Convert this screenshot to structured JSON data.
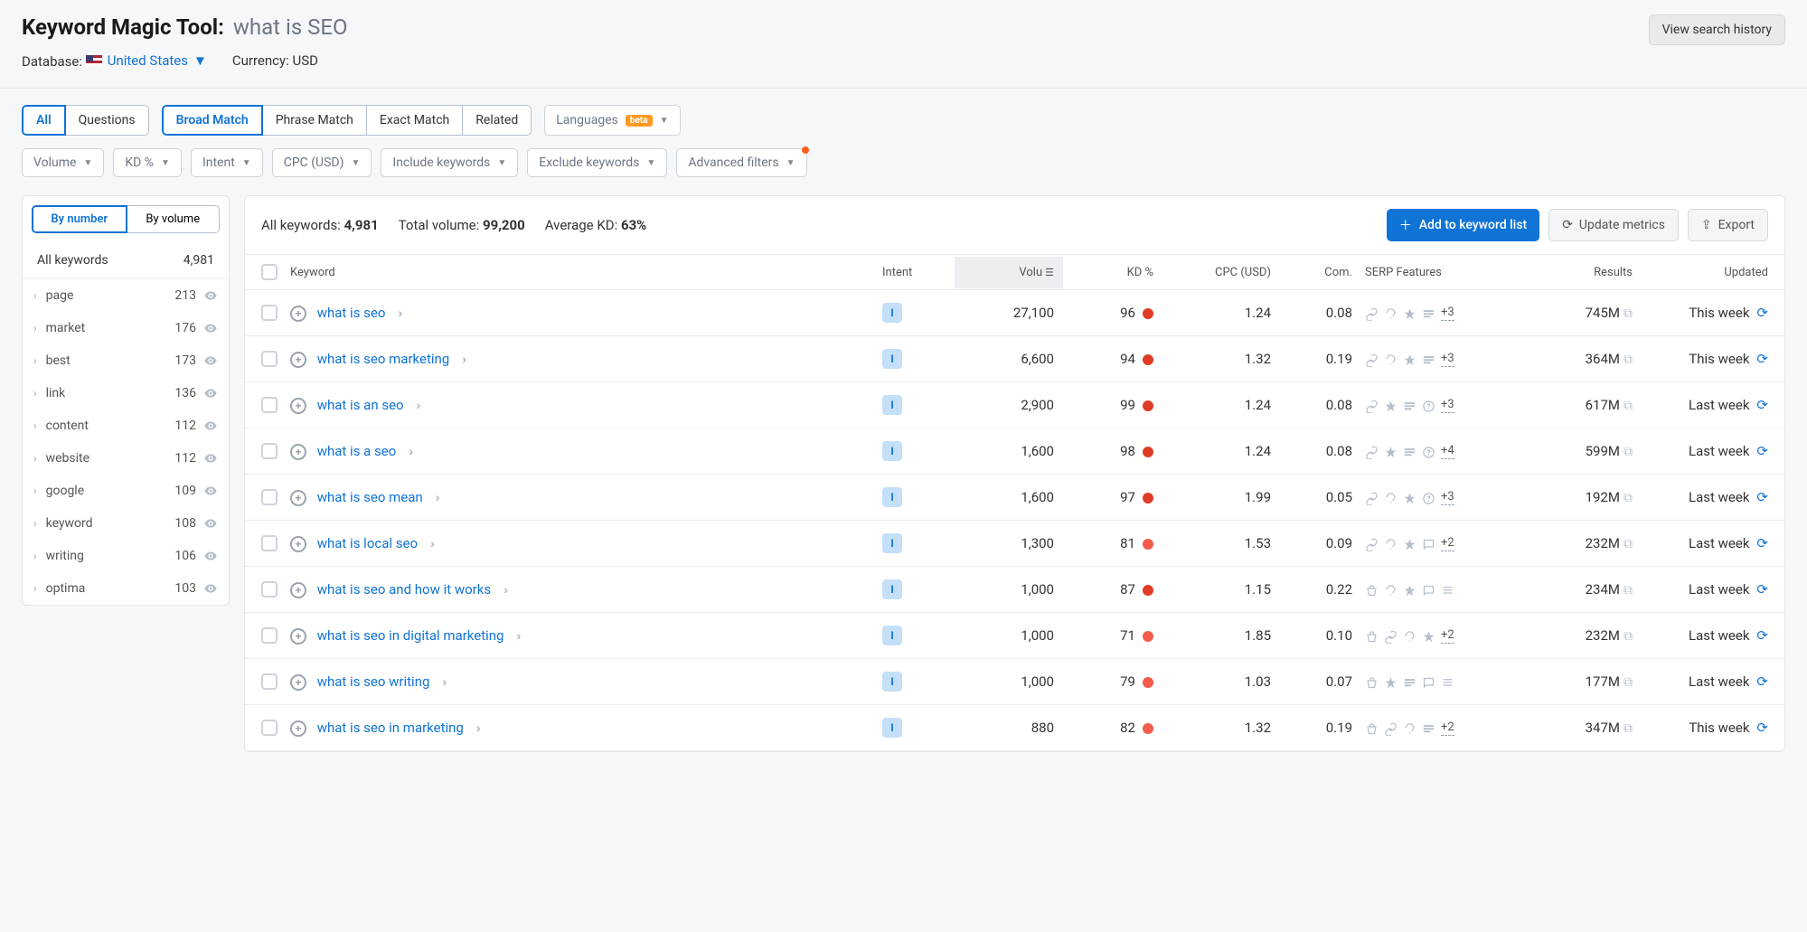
{
  "header": {
    "tool_name": "Keyword Magic Tool:",
    "query": "what is SEO",
    "history_btn": "View search history",
    "database_label": "Database:",
    "country": "United States",
    "currency_label": "Currency:",
    "currency": "USD"
  },
  "tabs1": {
    "all": "All",
    "questions": "Questions"
  },
  "tabs2": {
    "broad": "Broad Match",
    "phrase": "Phrase Match",
    "exact": "Exact Match",
    "related": "Related"
  },
  "languages": {
    "label": "Languages",
    "badge": "beta"
  },
  "filters": {
    "volume": "Volume",
    "kd": "KD %",
    "intent": "Intent",
    "cpc": "CPC (USD)",
    "include": "Include keywords",
    "exclude": "Exclude keywords",
    "advanced": "Advanced filters"
  },
  "sidebar": {
    "by_number": "By number",
    "by_volume": "By volume",
    "all_keywords": "All keywords",
    "total": "4,981",
    "items": [
      {
        "name": "page",
        "count": "213"
      },
      {
        "name": "market",
        "count": "176"
      },
      {
        "name": "best",
        "count": "173"
      },
      {
        "name": "link",
        "count": "136"
      },
      {
        "name": "content",
        "count": "112"
      },
      {
        "name": "website",
        "count": "112"
      },
      {
        "name": "google",
        "count": "109"
      },
      {
        "name": "keyword",
        "count": "108"
      },
      {
        "name": "writing",
        "count": "106"
      },
      {
        "name": "optima",
        "count": "103"
      }
    ]
  },
  "stats": {
    "all_label": "All keywords:",
    "all_val": "4,981",
    "vol_label": "Total volume:",
    "vol_val": "99,200",
    "kd_label": "Average KD:",
    "kd_val": "63%"
  },
  "actions": {
    "add": "Add to keyword list",
    "update": "Update metrics",
    "export": "Export"
  },
  "columns": {
    "keyword": "Keyword",
    "intent": "Intent",
    "volume": "Volu",
    "kd": "KD %",
    "cpc": "CPC (USD)",
    "com": "Com.",
    "serp": "SERP Features",
    "results": "Results",
    "updated": "Updated"
  },
  "rows": [
    {
      "kw": "what is seo",
      "intent": "I",
      "vol": "27,100",
      "kd": "96",
      "kd_dot": "high",
      "cpc": "1.24",
      "com": "0.08",
      "serp": [
        "link",
        "question",
        "star",
        "snippet"
      ],
      "more": "+3",
      "results": "745M",
      "updated": "This week"
    },
    {
      "kw": "what is seo marketing",
      "intent": "I",
      "vol": "6,600",
      "kd": "94",
      "kd_dot": "high",
      "cpc": "1.32",
      "com": "0.19",
      "serp": [
        "link",
        "question",
        "star",
        "snippet"
      ],
      "more": "+3",
      "results": "364M",
      "updated": "This week"
    },
    {
      "kw": "what is an seo",
      "intent": "I",
      "vol": "2,900",
      "kd": "99",
      "kd_dot": "high",
      "cpc": "1.24",
      "com": "0.08",
      "serp": [
        "link",
        "star",
        "snippet",
        "faq"
      ],
      "more": "+3",
      "results": "617M",
      "updated": "Last week"
    },
    {
      "kw": "what is a seo",
      "intent": "I",
      "vol": "1,600",
      "kd": "98",
      "kd_dot": "high",
      "cpc": "1.24",
      "com": "0.08",
      "serp": [
        "link",
        "star",
        "snippet",
        "faq"
      ],
      "more": "+4",
      "results": "599M",
      "updated": "Last week"
    },
    {
      "kw": "what is seo mean",
      "intent": "I",
      "vol": "1,600",
      "kd": "97",
      "kd_dot": "high",
      "cpc": "1.99",
      "com": "0.05",
      "serp": [
        "link",
        "question",
        "star",
        "faq"
      ],
      "more": "+3",
      "results": "192M",
      "updated": "Last week"
    },
    {
      "kw": "what is local seo",
      "intent": "I",
      "vol": "1,300",
      "kd": "81",
      "kd_dot": "med",
      "cpc": "1.53",
      "com": "0.09",
      "serp": [
        "link",
        "question",
        "star",
        "review"
      ],
      "more": "+2",
      "results": "232M",
      "updated": "Last week"
    },
    {
      "kw": "what is seo and how it works",
      "intent": "I",
      "vol": "1,000",
      "kd": "87",
      "kd_dot": "high",
      "cpc": "1.15",
      "com": "0.22",
      "serp": [
        "shop",
        "question",
        "star",
        "review",
        "list"
      ],
      "more": "",
      "results": "234M",
      "updated": "Last week"
    },
    {
      "kw": "what is seo in digital marketing",
      "intent": "I",
      "vol": "1,000",
      "kd": "71",
      "kd_dot": "med",
      "cpc": "1.85",
      "com": "0.10",
      "serp": [
        "shop",
        "link",
        "question",
        "star"
      ],
      "more": "+2",
      "results": "232M",
      "updated": "Last week"
    },
    {
      "kw": "what is seo writing",
      "intent": "I",
      "vol": "1,000",
      "kd": "79",
      "kd_dot": "med",
      "cpc": "1.03",
      "com": "0.07",
      "serp": [
        "shop",
        "star",
        "snippet",
        "review",
        "list"
      ],
      "more": "",
      "results": "177M",
      "updated": "Last week"
    },
    {
      "kw": "what is seo in marketing",
      "intent": "I",
      "vol": "880",
      "kd": "82",
      "kd_dot": "med",
      "cpc": "1.32",
      "com": "0.19",
      "serp": [
        "shop",
        "link",
        "question",
        "snippet"
      ],
      "more": "+2",
      "results": "347M",
      "updated": "This week"
    }
  ]
}
